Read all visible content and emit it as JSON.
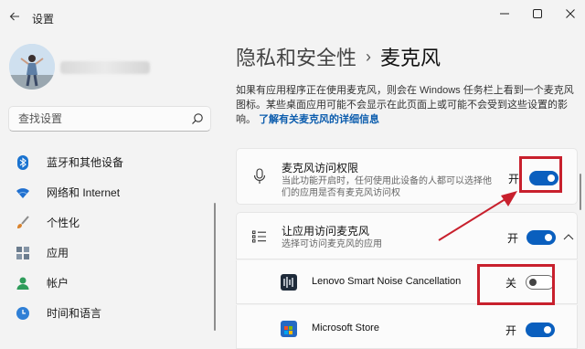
{
  "window": {
    "app_title": "设置"
  },
  "sidebar": {
    "search_placeholder": "查找设置",
    "items": [
      {
        "label": "蓝牙和其他设备",
        "icon": "bluetooth-icon"
      },
      {
        "label": "网络和 Internet",
        "icon": "wifi-icon"
      },
      {
        "label": "个性化",
        "icon": "brush-icon"
      },
      {
        "label": "应用",
        "icon": "apps-icon"
      },
      {
        "label": "帐户",
        "icon": "account-icon"
      },
      {
        "label": "时间和语言",
        "icon": "globe-clock-icon"
      }
    ]
  },
  "main": {
    "breadcrumb_parent": "隐私和安全性",
    "breadcrumb_separator": "›",
    "breadcrumb_current": "麦克风",
    "description": "如果有应用程序正在使用麦克风，则会在 Windows 任务栏上看到一个麦克风图标。某些桌面应用可能不会显示在此页面上或可能不会受到这些设置的影响。",
    "description_link": "了解有关麦克风的详细信息",
    "mic_access": {
      "title": "麦克风访问权限",
      "subtitle": "当此功能开启时，任何使用此设备的人都可以选择他们的应用是否有麦克风访问权",
      "state_label": "开",
      "enabled": true
    },
    "app_access": {
      "title": "让应用访问麦克风",
      "subtitle": "选择可访问麦克风的应用",
      "state_label": "开",
      "enabled": true,
      "expanded": true
    },
    "apps": [
      {
        "name": "Lenovo Smart Noise Cancellation",
        "state_label": "关",
        "enabled": false
      },
      {
        "name": "Microsoft Store",
        "state_label": "开",
        "enabled": true
      }
    ]
  },
  "colors": {
    "accent": "#0a5fbe",
    "highlight": "#c8202d",
    "link": "#0b5cad"
  }
}
